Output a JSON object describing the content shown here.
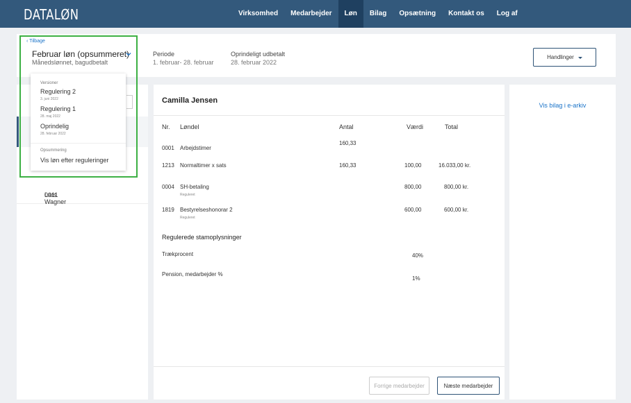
{
  "app": {
    "logo": "DATALØN"
  },
  "nav": {
    "items": [
      {
        "label": "Virksomhed",
        "active": false
      },
      {
        "label": "Medarbejder",
        "active": false
      },
      {
        "label": "Løn",
        "active": true
      },
      {
        "label": "Bilag",
        "active": false
      },
      {
        "label": "Opsætning",
        "active": false
      },
      {
        "label": "Kontakt os",
        "active": false
      },
      {
        "label": "Log af",
        "active": false
      }
    ]
  },
  "header": {
    "back_label": "Tilbage",
    "title": "Februar løn (opsummeret)",
    "subtitle": "Månedslønnet, bagudbetalt",
    "period_label": "Periode",
    "period_value": "1. februar- 28. februar",
    "paid_label": "Oprindeligt udbetalt",
    "paid_value": "28. februar 2022",
    "actions_label": "Handlinger"
  },
  "versions_dropdown": {
    "versions_label": "Versioner",
    "versions": [
      {
        "name": "Regulering 2",
        "date": "3. juni 2022"
      },
      {
        "name": "Regulering 1",
        "date": "28. maj 2022"
      },
      {
        "name": "Oprindelig",
        "date": "28. februar 2022"
      }
    ],
    "summary_label": "Opsummering",
    "summary_item": "Vis løn efter reguleringer"
  },
  "employees": [
    {
      "number": "0011",
      "name": "Lars Wagner"
    }
  ],
  "payslip": {
    "employee_name": "Camilla Jensen",
    "columns": {
      "nr": "Nr.",
      "item": "Løndel",
      "qty": "Antal",
      "value": "Værdi",
      "total": "Total"
    },
    "rows": [
      {
        "nr": "0001",
        "item": "Arbejdstimer",
        "note": "",
        "qty": "160,33",
        "value": "",
        "total": ""
      },
      {
        "nr": "1213",
        "item": "Normaltimer x sats",
        "note": "",
        "qty": "160,33",
        "value": "100,00",
        "total": "16.033,00 kr."
      },
      {
        "nr": "0004",
        "item": "SH-betaling",
        "note": "Reguleret",
        "qty": "",
        "value": "800,00",
        "total": "800,00 kr."
      },
      {
        "nr": "1819",
        "item": "Bestyrelseshonorar 2",
        "note": "Reguleret",
        "qty": "",
        "value": "600,00",
        "total": "600,00 kr."
      }
    ],
    "master_data_title": "Regulerede stamoplysninger",
    "master_data": [
      {
        "label": "Trækprocent",
        "value": "40%"
      },
      {
        "label": "Pension, medarbejder %",
        "value": "1%"
      }
    ],
    "prev_button": "Forrige medarbejder",
    "next_button": "Næste medarbejder"
  },
  "right_panel": {
    "archive_link": "Vis bilag i e-arkiv"
  },
  "colors": {
    "nav_bg": "#33597c",
    "nav_active": "#1f4060",
    "link": "#1a73c8",
    "highlight": "#3cb043"
  }
}
